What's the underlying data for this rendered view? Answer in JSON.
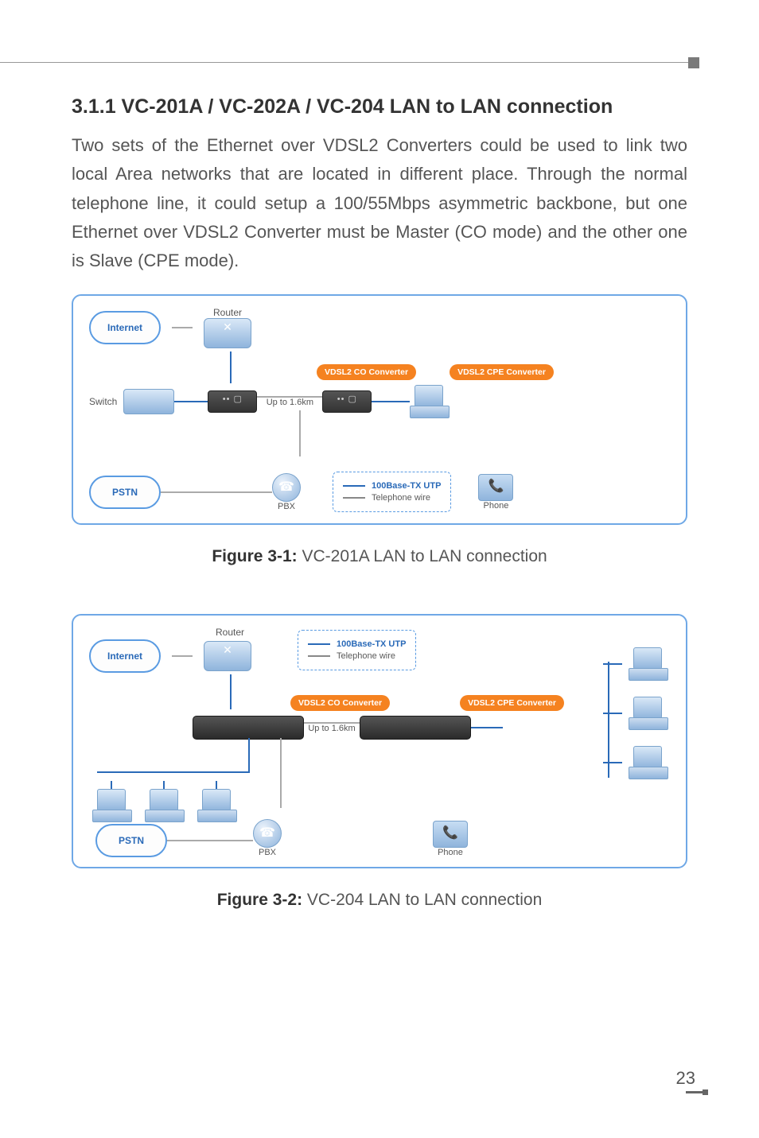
{
  "section": {
    "heading": "3.1.1 VC-201A / VC-202A / VC-204 LAN to LAN connection",
    "body": "Two sets of the Ethernet over VDSL2 Converters could be used to link two local Area networks that are located in different place. Through the normal telephone line, it could setup a 100/55Mbps asymmetric backbone, but one Ethernet over VDSL2 Converter must be Master (CO mode) and the other one is Slave (CPE mode)."
  },
  "figure1": {
    "caption_bold": "Figure 3-1:",
    "caption_rest": "  VC-201A LAN to LAN connection",
    "internet": "Internet",
    "pstn": "PSTN",
    "router": "Router",
    "switch": "Switch",
    "co_label": "VDSL2 CO Converter",
    "cpe_label": "VDSL2 CPE Converter",
    "distance": "Up to 1.6km",
    "pbx": "PBX",
    "phone": "Phone",
    "legend_utp": "100Base-TX UTP",
    "legend_tel": "Telephone wire"
  },
  "figure2": {
    "caption_bold": "Figure 3-2:",
    "caption_rest": "  VC-204 LAN to LAN connection",
    "internet": "Internet",
    "pstn": "PSTN",
    "router": "Router",
    "co_label": "VDSL2 CO Converter",
    "cpe_label": "VDSL2 CPE Converter",
    "distance": "Up to 1.6km",
    "pbx": "PBX",
    "phone": "Phone",
    "legend_utp": "100Base-TX UTP",
    "legend_tel": "Telephone wire"
  },
  "page_number": "23"
}
